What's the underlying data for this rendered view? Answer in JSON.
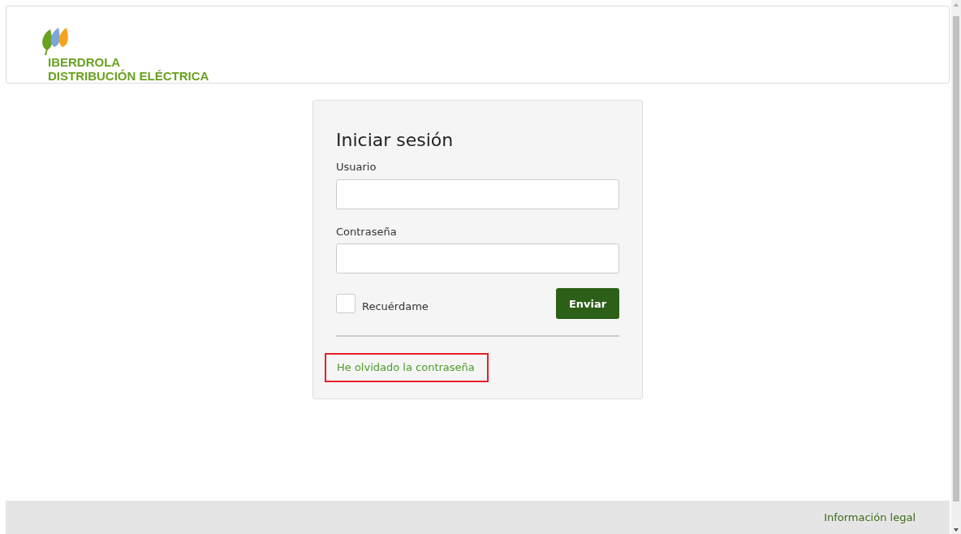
{
  "header": {
    "logo_line_1": "IBERDROLA",
    "logo_line_2": "DISTRIBUCIÓN ELÉCTRICA"
  },
  "login": {
    "title": "Iniciar sesión",
    "fields": [
      {
        "label": "Usuario"
      },
      {
        "label": "Contraseña"
      }
    ],
    "remember": {
      "label": "Recuérdame",
      "checked": false
    },
    "submit": "Enviar",
    "forgot_link": {
      "label": "He olvidado la contraseña",
      "highlighted": true
    }
  },
  "footer": {
    "link": "Información legal"
  }
}
